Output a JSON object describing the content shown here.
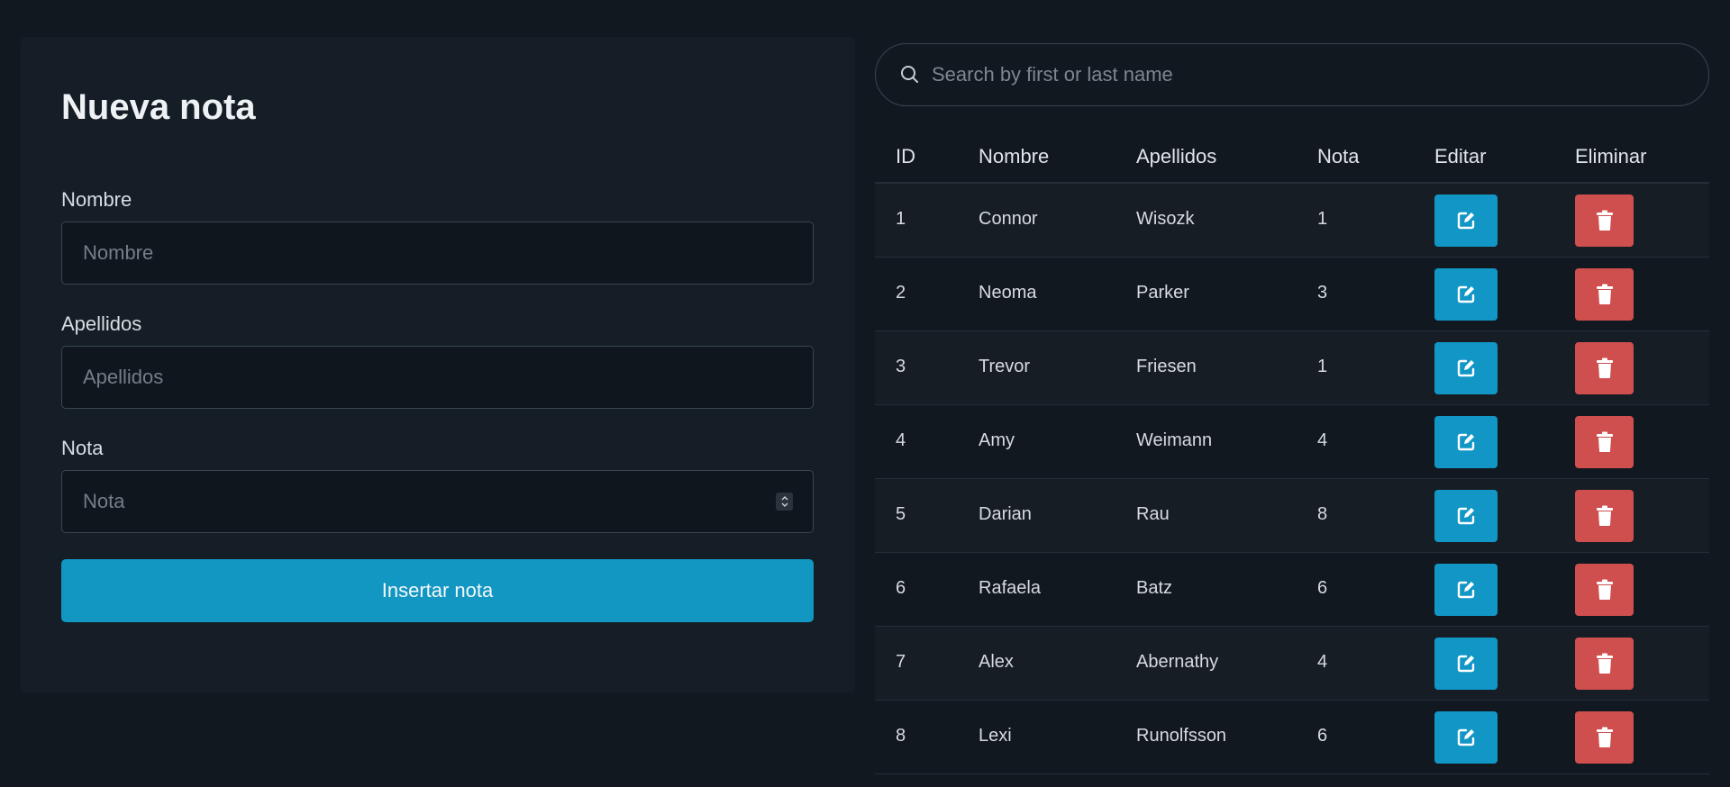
{
  "form": {
    "title": "Nueva nota",
    "nombre_label": "Nombre",
    "nombre_placeholder": "Nombre",
    "apellidos_label": "Apellidos",
    "apellidos_placeholder": "Apellidos",
    "nota_label": "Nota",
    "nota_placeholder": "Nota",
    "submit_label": "Insertar nota"
  },
  "search": {
    "placeholder": "Search by first or last name"
  },
  "table": {
    "headers": [
      "ID",
      "Nombre",
      "Apellidos",
      "Nota",
      "Editar",
      "Eliminar"
    ],
    "rows": [
      {
        "id": "1",
        "nombre": "Connor",
        "apellidos": "Wisozk",
        "nota": "1"
      },
      {
        "id": "2",
        "nombre": "Neoma",
        "apellidos": "Parker",
        "nota": "3"
      },
      {
        "id": "3",
        "nombre": "Trevor",
        "apellidos": "Friesen",
        "nota": "1"
      },
      {
        "id": "4",
        "nombre": "Amy",
        "apellidos": "Weimann",
        "nota": "4"
      },
      {
        "id": "5",
        "nombre": "Darian",
        "apellidos": "Rau",
        "nota": "8"
      },
      {
        "id": "6",
        "nombre": "Rafaela",
        "apellidos": "Batz",
        "nota": "6"
      },
      {
        "id": "7",
        "nombre": "Alex",
        "apellidos": "Abernathy",
        "nota": "4"
      },
      {
        "id": "8",
        "nombre": "Lexi",
        "apellidos": "Runolfsson",
        "nota": "6"
      }
    ]
  },
  "icons": {
    "search": "search-icon",
    "edit": "edit-icon",
    "delete": "trash-icon",
    "spinner": "chevron-up-down-icon"
  },
  "colors": {
    "background": "#111820",
    "card": "#151e26",
    "primary": "#1296c2",
    "danger": "#cf4f4f"
  }
}
